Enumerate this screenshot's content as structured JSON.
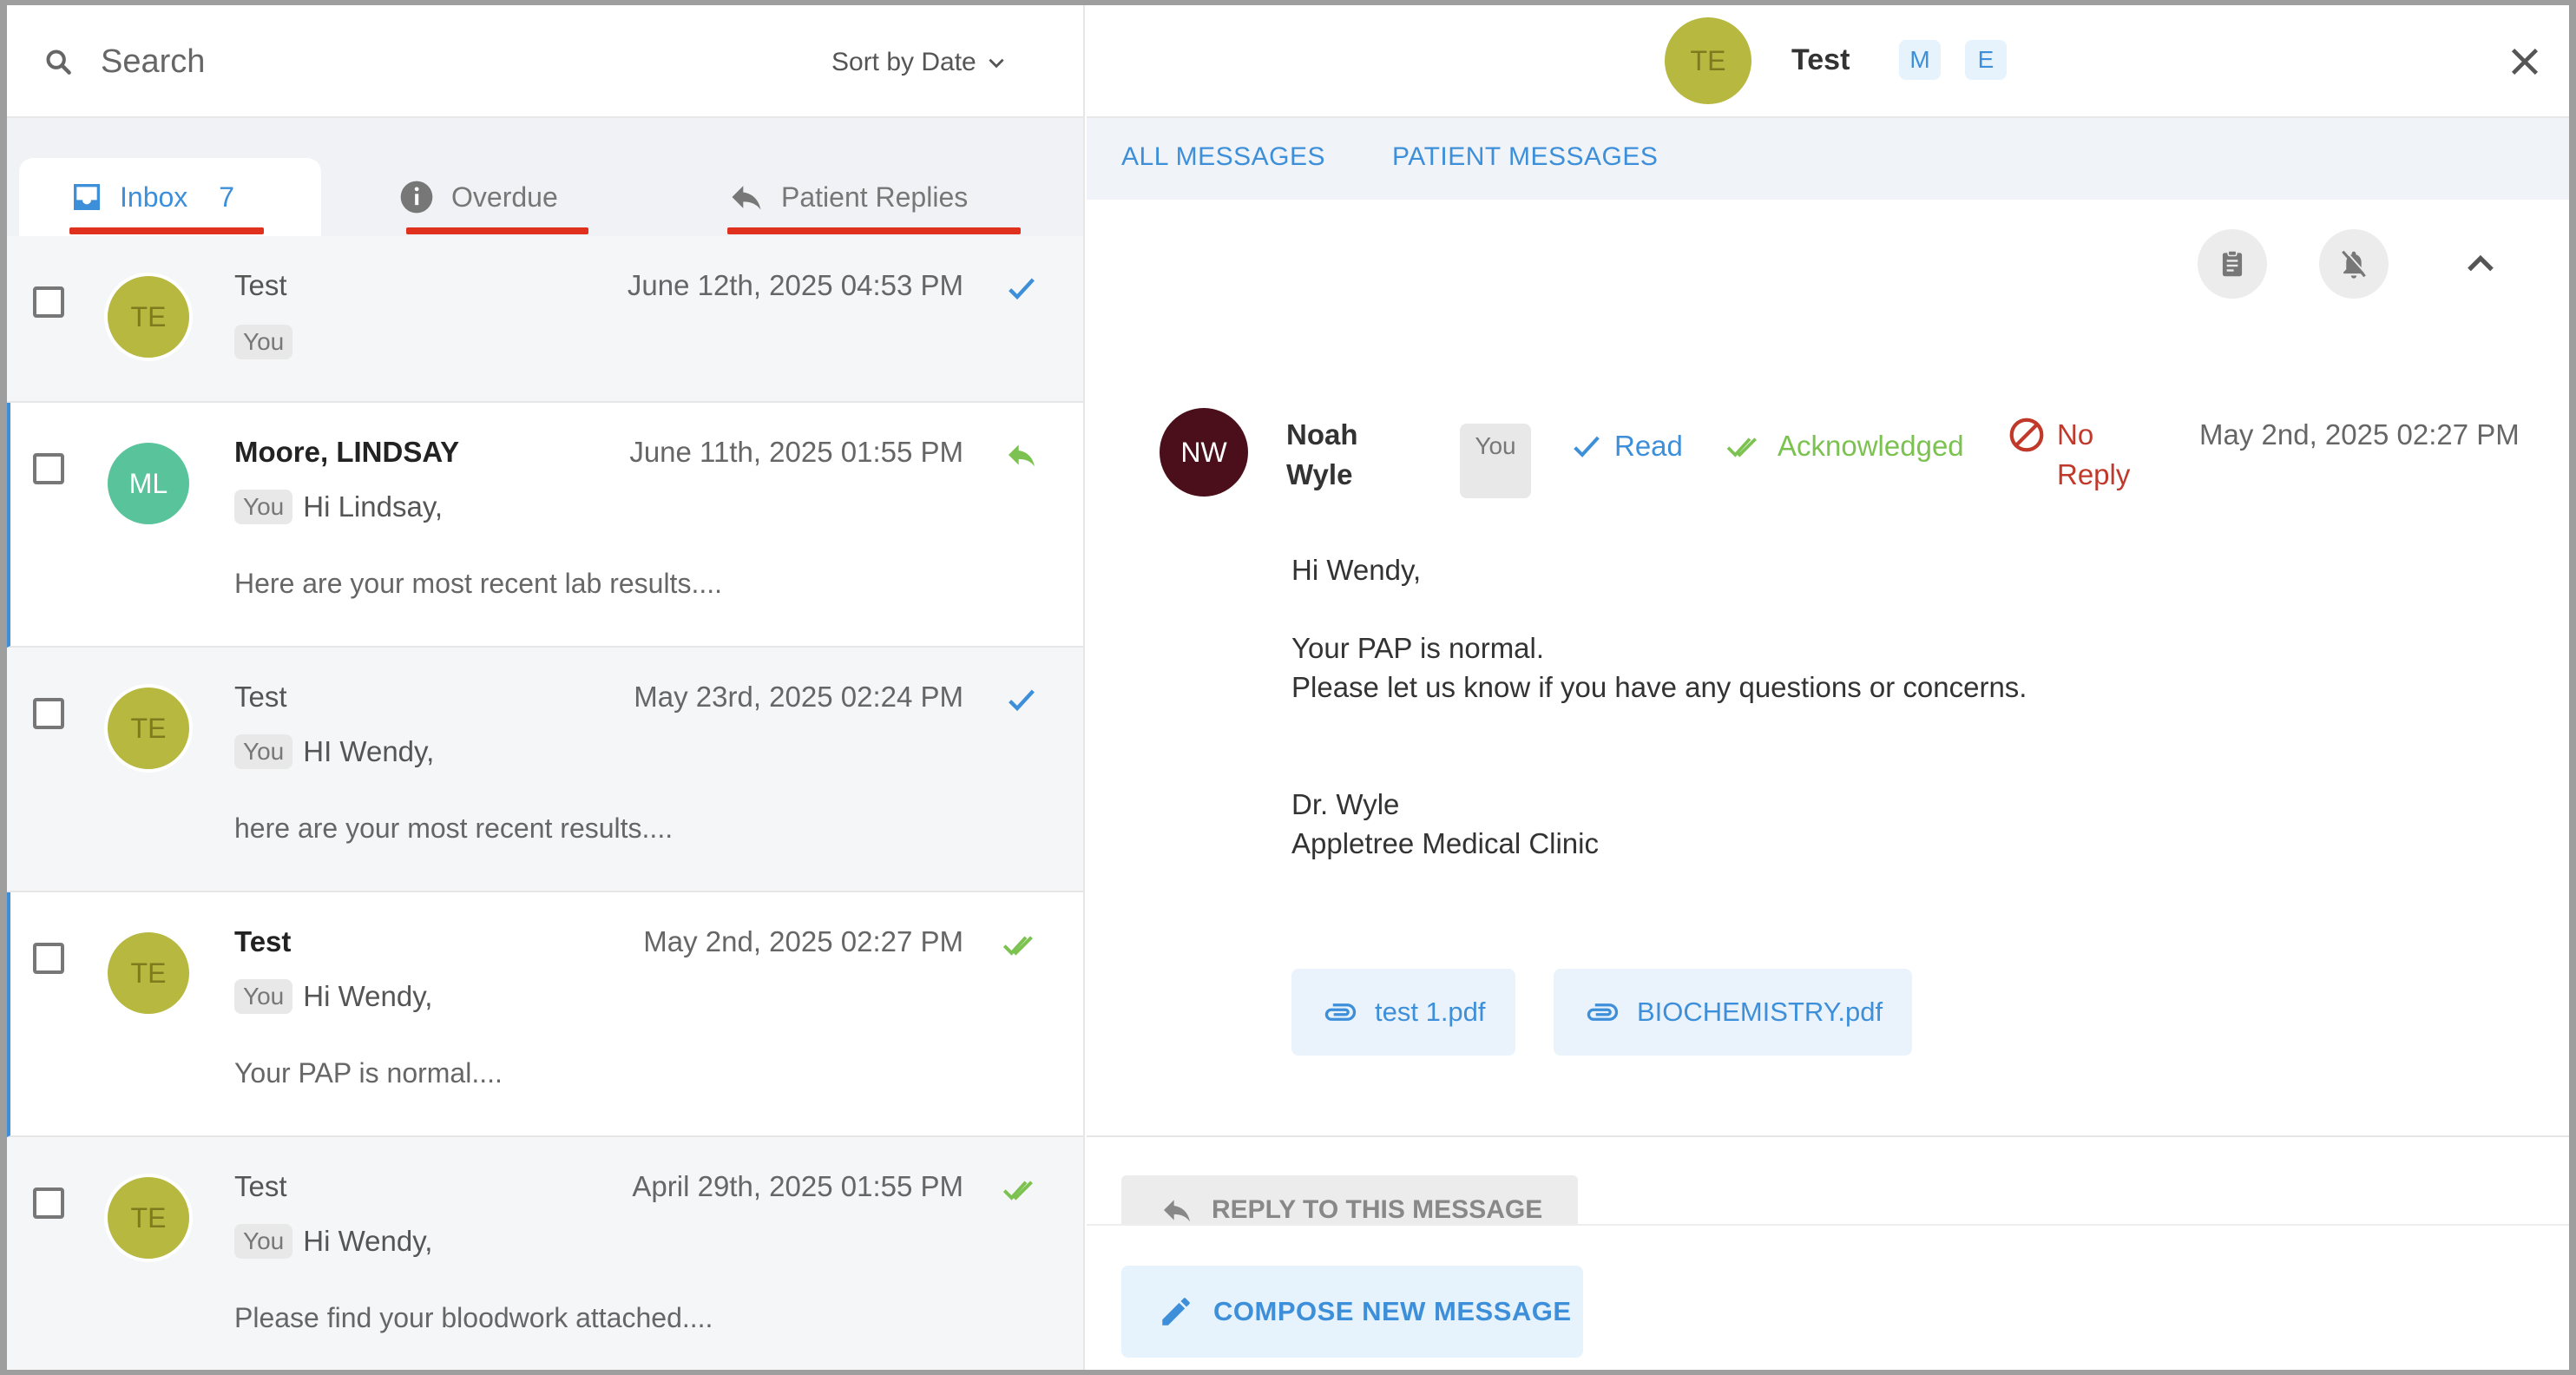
{
  "search": {
    "placeholder": "Search",
    "sort_label": "Sort by Date"
  },
  "tabs": {
    "inbox": {
      "label": "Inbox",
      "count": "7"
    },
    "overdue": {
      "label": "Overdue"
    },
    "replies": {
      "label": "Patient Replies"
    }
  },
  "messages": [
    {
      "initials": "TE",
      "name": "Test",
      "date": "June 12th, 2025 04:53 PM",
      "you": "You",
      "subject": "",
      "preview": "",
      "status": "read-check"
    },
    {
      "initials": "ML",
      "name": "Moore, LINDSAY",
      "date": "June 11th, 2025 01:55 PM",
      "you": "You",
      "subject": "Hi Lindsay,",
      "preview": "Here are your most recent lab results....",
      "status": "replied"
    },
    {
      "initials": "TE",
      "name": "Test",
      "date": "May 23rd, 2025 02:24 PM",
      "you": "You",
      "subject": "HI Wendy,",
      "preview": "here are your most recent results....",
      "status": "read-check"
    },
    {
      "initials": "TE",
      "name": "Test",
      "date": "May 2nd, 2025 02:27 PM",
      "you": "You",
      "subject": "Hi Wendy,",
      "preview": "Your PAP is normal....",
      "status": "acknowledged"
    },
    {
      "initials": "TE",
      "name": "Test",
      "date": "April 29th, 2025 01:55 PM",
      "you": "You",
      "subject": "Hi Wendy,",
      "preview": "Please find your bloodwork attached....",
      "status": "acknowledged"
    }
  ],
  "detail": {
    "header": {
      "initials": "TE",
      "name": "Test",
      "chip_m": "M",
      "chip_e": "E"
    },
    "tabs": {
      "all": "ALL MESSAGES",
      "patient": "PATIENT MESSAGES"
    },
    "message": {
      "initials": "NW",
      "sender": "Noah Wyle",
      "you": "You",
      "status_read": "Read",
      "status_ack": "Acknowledged",
      "status_noreply": "No Reply",
      "date": "May 2nd, 2025 02:27 PM",
      "body": [
        "Hi Wendy,",
        "",
        "Your PAP is normal.",
        "Please let us know if you have any questions or concerns.",
        "",
        "",
        "Dr. Wyle",
        "Appletree Medical Clinic"
      ],
      "attachments": [
        "test 1.pdf",
        "BIOCHEMISTRY.pdf"
      ]
    },
    "reply_label": "REPLY TO THIS MESSAGE",
    "compose_label": "COMPOSE NEW MESSAGE"
  },
  "colors": {
    "accent": "#3d8fd9",
    "tab_underline": "#e0301e",
    "acknowledged": "#7cc251",
    "no_reply": "#c0392b",
    "avatar_te": "#b7b840",
    "avatar_ml": "#59c49b",
    "avatar_nw": "#4a0f1a"
  }
}
